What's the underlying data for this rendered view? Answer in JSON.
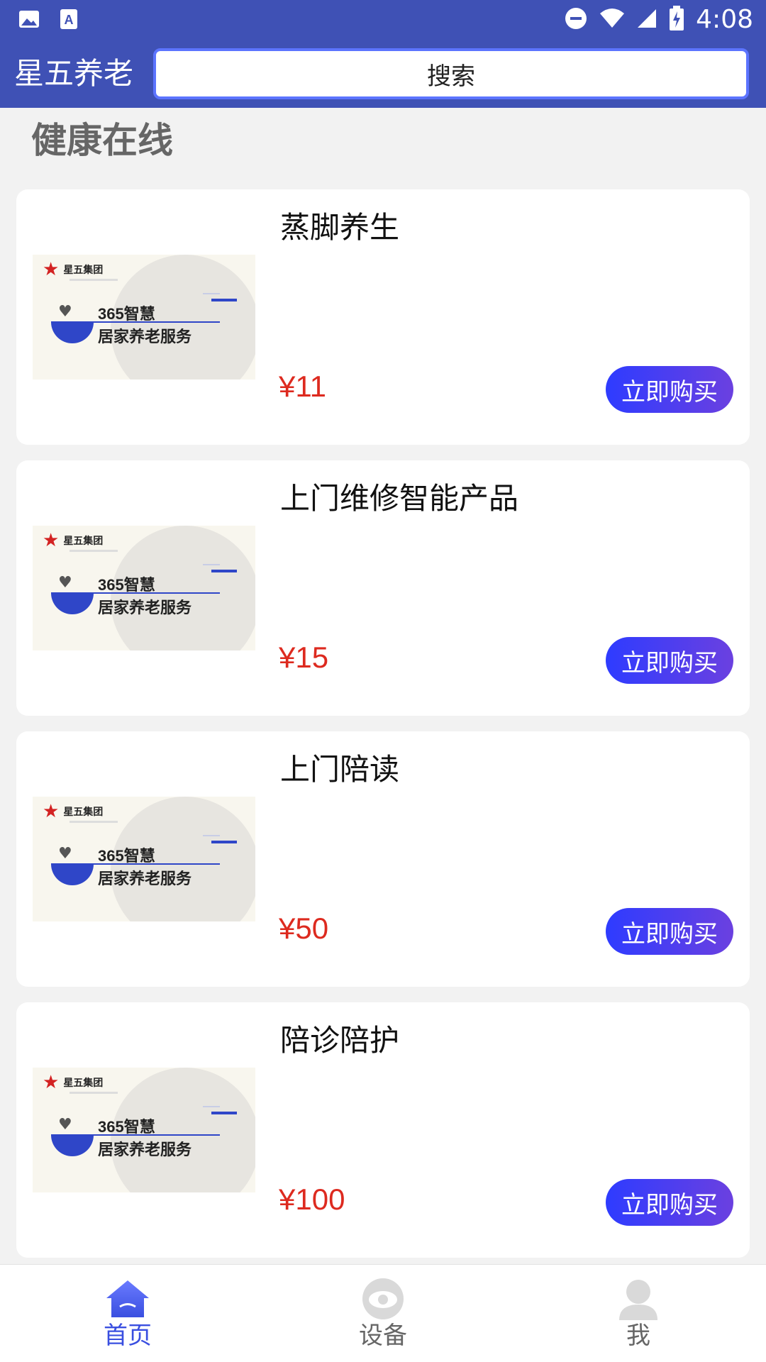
{
  "status_bar": {
    "time": "4:08",
    "icons": [
      "image-icon",
      "a-icon",
      "dnd-icon",
      "wifi-icon",
      "signal-icon",
      "battery-charging-icon"
    ]
  },
  "header": {
    "app_title": "星五养老",
    "search_label": "搜索"
  },
  "section": {
    "title": "健康在线"
  },
  "products": [
    {
      "name": "蒸脚养生",
      "price": "¥11",
      "buy_label": "立即购买"
    },
    {
      "name": "上门维修智能产品",
      "price": "¥15",
      "buy_label": "立即购买"
    },
    {
      "name": "上门陪读",
      "price": "¥50",
      "buy_label": "立即购买"
    },
    {
      "name": "陪诊陪护",
      "price": "¥100",
      "buy_label": "立即购买"
    }
  ],
  "product_image": {
    "brand": "星五集团",
    "line1": "365智慧",
    "line2": "居家养老服务"
  },
  "bottom_nav": [
    {
      "label": "首页",
      "icon": "home-icon",
      "active": true
    },
    {
      "label": "设备",
      "icon": "device-icon",
      "active": false
    },
    {
      "label": "我",
      "icon": "user-icon",
      "active": false
    }
  ],
  "colors": {
    "header_bg": "#3f51b5",
    "accent": "#3a4fe0",
    "price": "#dd2a1f",
    "button_gradient_start": "#2e3cff",
    "button_gradient_end": "#6b40e0"
  }
}
